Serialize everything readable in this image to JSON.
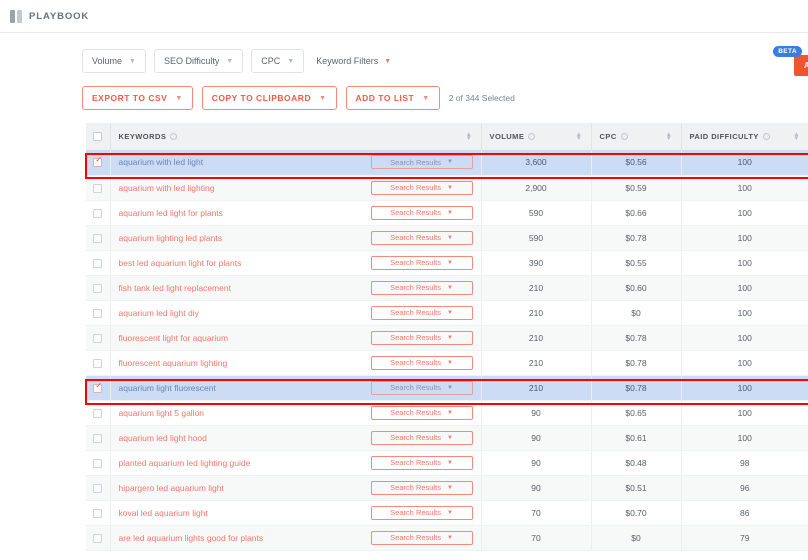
{
  "app": {
    "logo_text": "PLAYBOOK",
    "beta_badge": "BETA",
    "beta_button": "A"
  },
  "filters": [
    {
      "label": "Volume",
      "type": "dropdown"
    },
    {
      "label": "SEO Difficulty",
      "type": "dropdown"
    },
    {
      "label": "CPC",
      "type": "dropdown"
    },
    {
      "label": "Keyword Filters",
      "type": "plain"
    }
  ],
  "actions": {
    "export_csv": "EXPORT TO CSV",
    "copy_clipboard": "COPY TO CLIPBOARD",
    "add_to_list": "ADD TO LIST",
    "selected_count": "2 of 344 Selected"
  },
  "table": {
    "headers": {
      "keywords": "KEYWORDS",
      "volume": "VOLUME",
      "cpc": "CPC",
      "paid_difficulty": "PAID DIFFICULTY"
    },
    "serp_button_label": "Search Results",
    "rows": [
      {
        "keyword": "aquarium with led light",
        "volume": "3,600",
        "cpc": "$0.56",
        "paid_difficulty": "100",
        "selected": true
      },
      {
        "keyword": "aquarium with led lighting",
        "volume": "2,900",
        "cpc": "$0.59",
        "paid_difficulty": "100",
        "selected": false
      },
      {
        "keyword": "aquarium led light for plants",
        "volume": "590",
        "cpc": "$0.66",
        "paid_difficulty": "100",
        "selected": false
      },
      {
        "keyword": "aquarium lighting led plants",
        "volume": "590",
        "cpc": "$0.78",
        "paid_difficulty": "100",
        "selected": false
      },
      {
        "keyword": "best led aquarium light for plants",
        "volume": "390",
        "cpc": "$0.55",
        "paid_difficulty": "100",
        "selected": false
      },
      {
        "keyword": "fish tank led light replacement",
        "volume": "210",
        "cpc": "$0.60",
        "paid_difficulty": "100",
        "selected": false
      },
      {
        "keyword": "aquarium led light diy",
        "volume": "210",
        "cpc": "$0",
        "paid_difficulty": "100",
        "selected": false
      },
      {
        "keyword": "fluorescent light for aquarium",
        "volume": "210",
        "cpc": "$0.78",
        "paid_difficulty": "100",
        "selected": false
      },
      {
        "keyword": "fluorescent aquarium lighting",
        "volume": "210",
        "cpc": "$0.78",
        "paid_difficulty": "100",
        "selected": false
      },
      {
        "keyword": "aquarium light fluorescent",
        "volume": "210",
        "cpc": "$0.78",
        "paid_difficulty": "100",
        "selected": true
      },
      {
        "keyword": "aquarium light 5 gallon",
        "volume": "90",
        "cpc": "$0.65",
        "paid_difficulty": "100",
        "selected": false
      },
      {
        "keyword": "aquarium led light hood",
        "volume": "90",
        "cpc": "$0.61",
        "paid_difficulty": "100",
        "selected": false
      },
      {
        "keyword": "planted aquarium led lighting guide",
        "volume": "90",
        "cpc": "$0.48",
        "paid_difficulty": "98",
        "selected": false
      },
      {
        "keyword": "hipargero led aquarium light",
        "volume": "90",
        "cpc": "$0.51",
        "paid_difficulty": "96",
        "selected": false
      },
      {
        "keyword": "koval led aquarium light",
        "volume": "70",
        "cpc": "$0.70",
        "paid_difficulty": "86",
        "selected": false
      },
      {
        "keyword": "are led aquarium lights good for plants",
        "volume": "70",
        "cpc": "$0",
        "paid_difficulty": "79",
        "selected": false
      }
    ]
  },
  "colors": {
    "accent_red": "#f2776b",
    "action_red": "#f05a4a",
    "selected_row": "#ccdcf5",
    "beta_blue": "#3b7ddd",
    "beta_orange": "#f2542d",
    "annotation_red": "#ff0000"
  }
}
